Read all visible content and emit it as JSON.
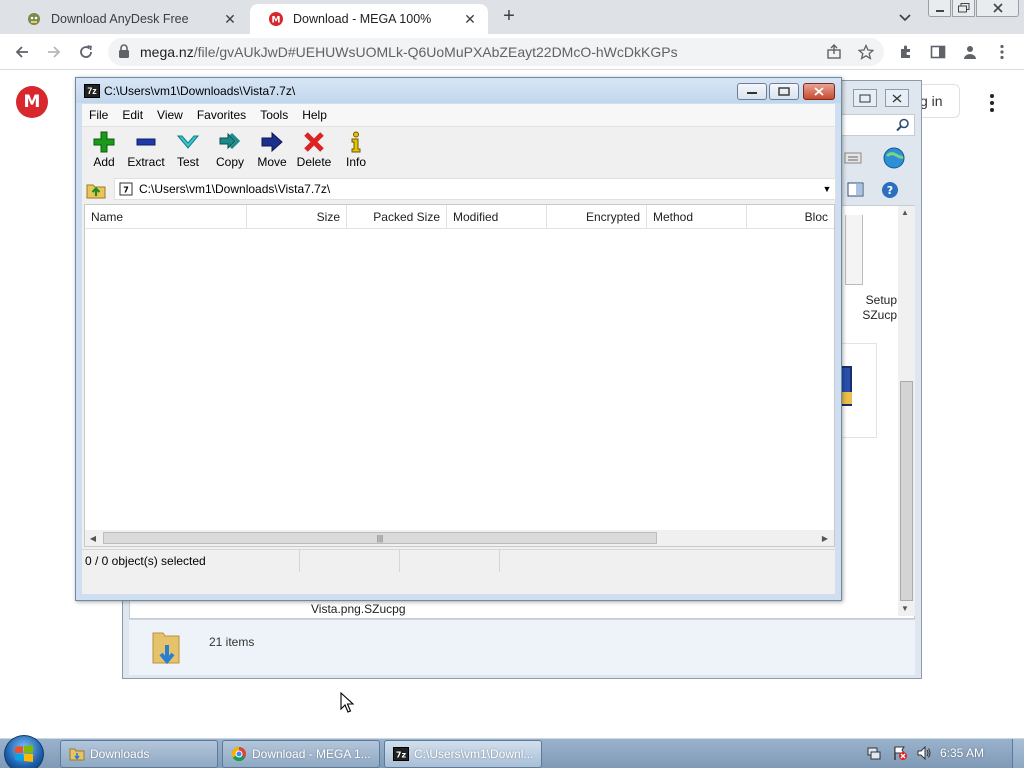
{
  "browser": {
    "tabs": [
      {
        "title": "Download AnyDesk Free",
        "favicon": "anydesk-icon",
        "active": false
      },
      {
        "title": "Download - MEGA 100%",
        "favicon": "mega-icon",
        "active": true
      }
    ],
    "url_host": "mega.nz",
    "url_path": "/file/gvAUkJwD#UEHUWsUOMLk-Q6UoMuPXAbZEayt22DMcO-hWcDkKGPs"
  },
  "mega": {
    "logo": "M",
    "signin_partial": "g in"
  },
  "bg_window": {
    "thumb_text_line1": "Setup",
    "thumb_text_line2": "SZucp",
    "file_name": "Vista.png.SZucpg",
    "items_count": "21 items"
  },
  "sevenzip": {
    "app_icon": "7z",
    "title": "C:\\Users\\vm1\\Downloads\\Vista7.7z\\",
    "menu": [
      "File",
      "Edit",
      "View",
      "Favorites",
      "Tools",
      "Help"
    ],
    "tools": [
      {
        "label": "Add",
        "icon": "plus-icon"
      },
      {
        "label": "Extract",
        "icon": "minus-icon"
      },
      {
        "label": "Test",
        "icon": "check-icon"
      },
      {
        "label": "Copy",
        "icon": "double-arrow-icon"
      },
      {
        "label": "Move",
        "icon": "arrow-right-icon"
      },
      {
        "label": "Delete",
        "icon": "x-icon"
      },
      {
        "label": "Info",
        "icon": "info-icon"
      }
    ],
    "path": "C:\\Users\\vm1\\Downloads\\Vista7.7z\\",
    "columns": [
      "Name",
      "Size",
      "Packed Size",
      "Modified",
      "Encrypted",
      "Method",
      "Bloc"
    ],
    "status": "0 / 0 object(s) selected"
  },
  "taskbar": {
    "buttons": [
      {
        "label": "Downloads",
        "icon": "folder-icon"
      },
      {
        "label": "Download - MEGA 1...",
        "icon": "chrome-icon"
      },
      {
        "label": "C:\\Users\\vm1\\Downl...",
        "icon": "7zip-icon"
      }
    ],
    "clock": "6:35 AM"
  },
  "colors": {
    "mega_red": "#d9272e",
    "delete_red": "#d22",
    "add_green": "#1a9a1a",
    "extract_blue": "#1f3aa8"
  }
}
